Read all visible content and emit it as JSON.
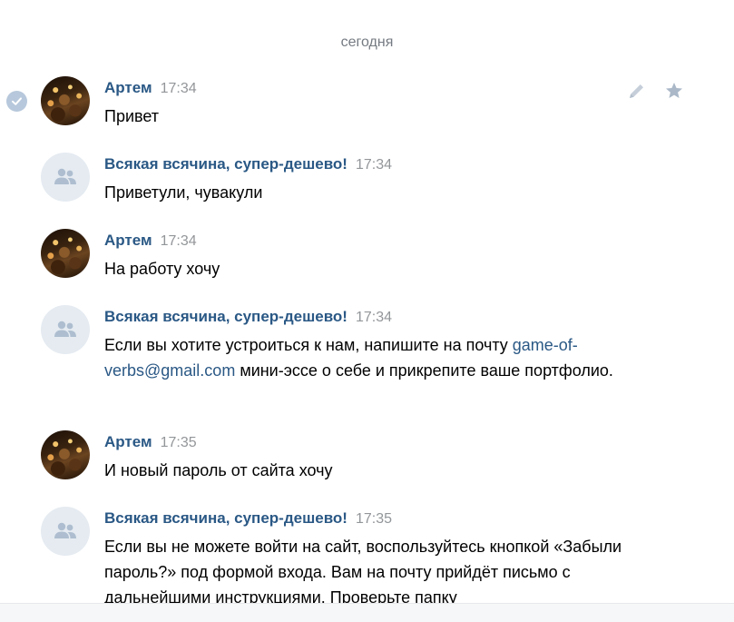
{
  "date_separator": "сегодня",
  "messages": [
    {
      "author": "Артем",
      "time": "17:34",
      "avatar": "user-photo",
      "text": "Привет"
    },
    {
      "author": "Всякая всячина, супер-дешево!",
      "time": "17:34",
      "avatar": "group-icon",
      "text": "Приветули, чувакули"
    },
    {
      "author": "Артем",
      "time": "17:34",
      "avatar": "user-photo",
      "text": "На работу хочу"
    },
    {
      "author": "Всякая всячина, супер-дешево!",
      "time": "17:34",
      "avatar": "group-icon",
      "text_before": "Если вы хотите устроиться к нам, напишите на почту ",
      "link": "game-of-verbs@gmail.com",
      "text_after": " мини-эссе о себе и прикрепите ваше портфолио."
    },
    {
      "author": "Артем",
      "time": "17:35",
      "avatar": "user-photo",
      "text": "И новый пароль от сайта хочу"
    },
    {
      "author": "Всякая всячина, супер-дешево!",
      "time": "17:35",
      "avatar": "group-icon",
      "text": "Если вы не можете войти на сайт, воспользуйтесь кнопкой «Забыли пароль?» под формой входа. Вам на почту прийдёт письмо с дальнейшими инструкциями. Проверьте папку"
    }
  ],
  "icons": {
    "selected": "check-circle-icon",
    "edit": "pencil-icon",
    "favorite": "star-icon",
    "group_avatar": "group-users-icon"
  },
  "colors": {
    "author": "#2a5885",
    "link": "#2a5885",
    "time": "#939699",
    "date_separator": "#757b82",
    "group_avatar_bg": "#e5ebf1",
    "group_avatar_fg": "#aebed0",
    "check_bg": "#b7c8dc"
  }
}
